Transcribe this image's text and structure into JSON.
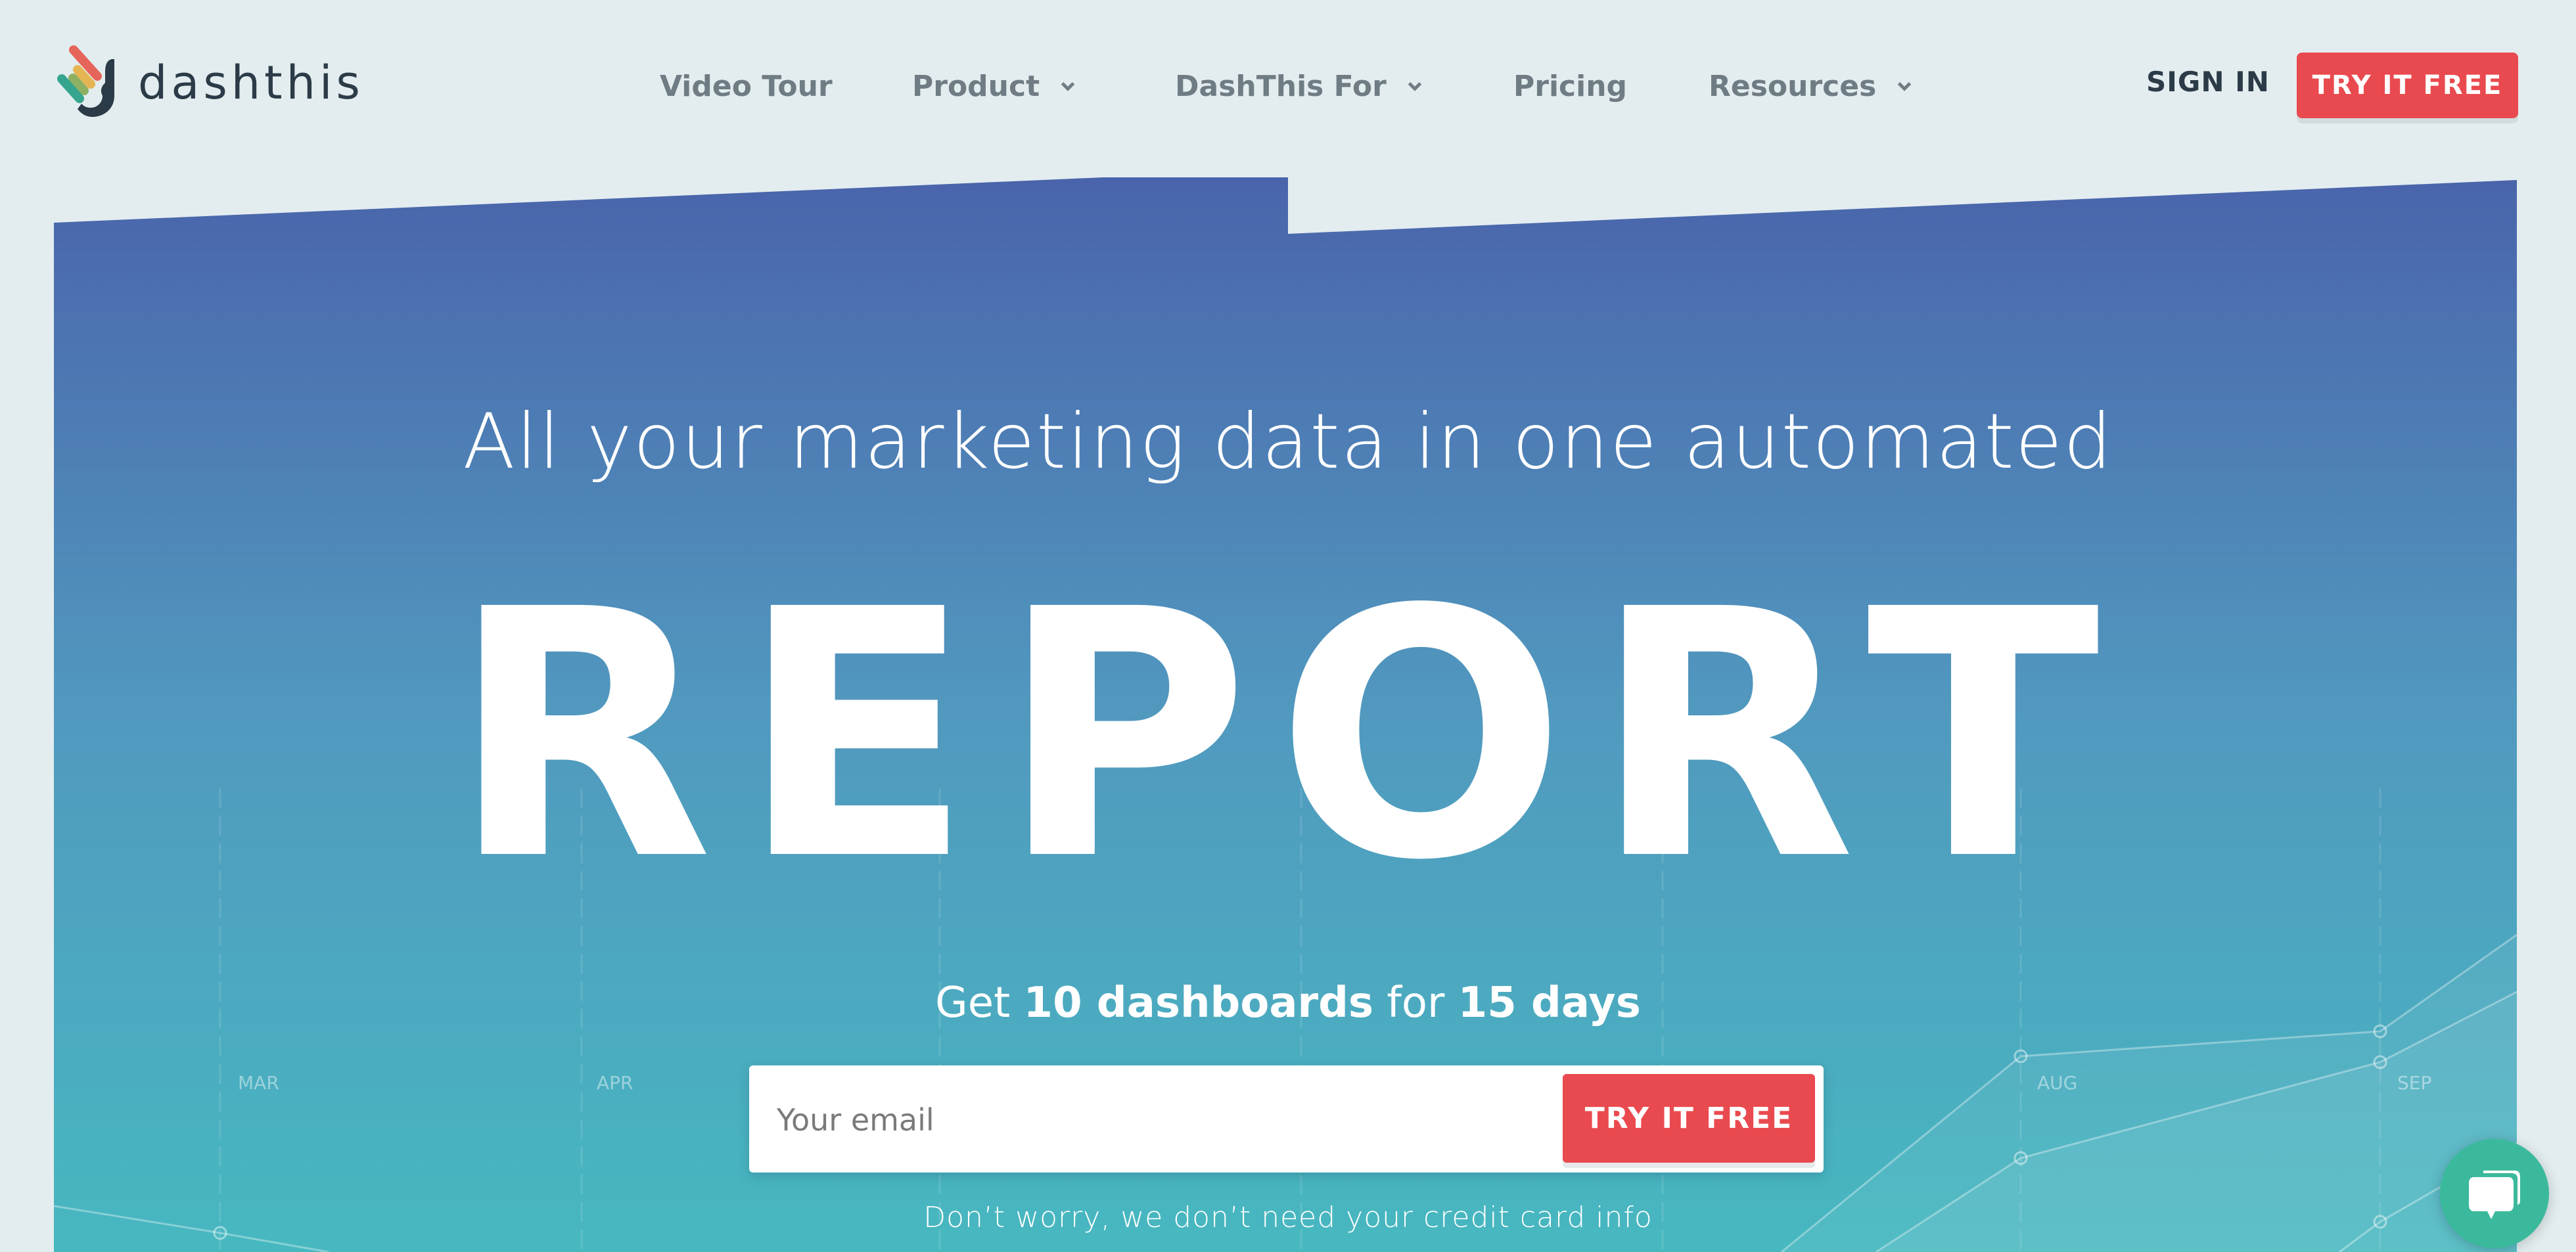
{
  "header": {
    "logo_text": "dashthis",
    "nav": [
      {
        "label": "Video Tour",
        "has_dropdown": false
      },
      {
        "label": "Product",
        "has_dropdown": true
      },
      {
        "label": "DashThis For",
        "has_dropdown": true
      },
      {
        "label": "Pricing",
        "has_dropdown": false
      },
      {
        "label": "Resources",
        "has_dropdown": true
      }
    ],
    "sign_in": "SIGN IN",
    "cta": "TRY IT FREE"
  },
  "hero": {
    "headline": "All your marketing data in one automated",
    "big_word": "REPORT",
    "offer": {
      "prefix": "Get",
      "dashboards": "10 dashboards",
      "middle": "for",
      "days": "15 days"
    },
    "email_placeholder": "Your email",
    "email_value": "",
    "form_cta": "TRY IT FREE",
    "disclaimer": "Don’t worry, we don’t need your credit card info",
    "background_chart_months": [
      "MAR",
      "APR",
      "AUG",
      "SEP"
    ]
  },
  "colors": {
    "page_bg": "#e3edef",
    "brand_red": "#e94a4f",
    "banner_top": "#4a64ab",
    "banner_bottom": "#47b8c0",
    "nav_text": "#6f7c83",
    "dark_text": "#2b3b47",
    "chat_green": "#3bb99c"
  },
  "chat_widget": {
    "icon": "chat-bubbles-icon"
  }
}
